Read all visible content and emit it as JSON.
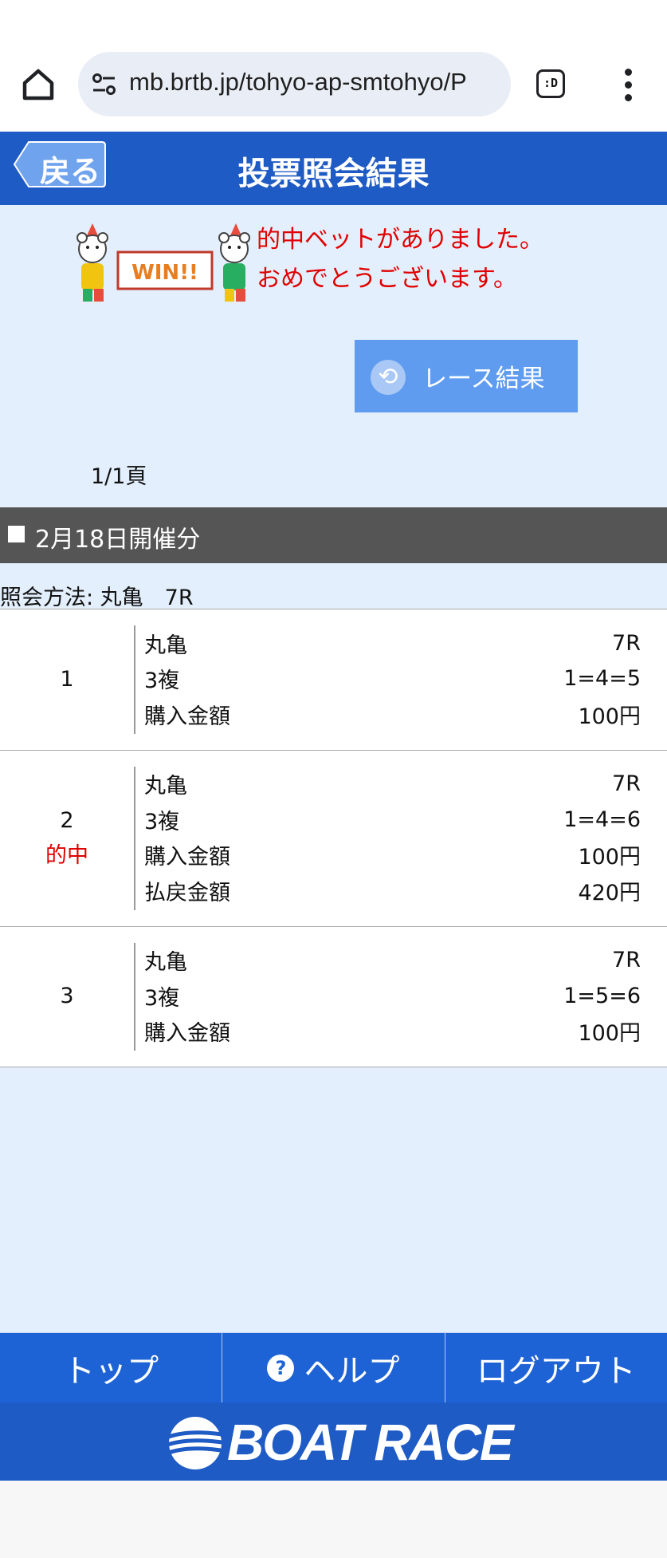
{
  "browser": {
    "url": "mb.brtb.jp/tohyo-ap-smtohyo/P",
    "tabs_label": ":D",
    "icons": [
      "home-icon",
      "site-settings-icon",
      "tab-switcher-icon",
      "more-vert-icon"
    ]
  },
  "header": {
    "back_label": "戻る",
    "title": "投票照会結果",
    "color": "#1f5bc5"
  },
  "win_banner": {
    "sign_text": "WIN!!",
    "line1": "的中ベットがありました。",
    "line2": "おめでとうございます。",
    "message_color": "#e00000"
  },
  "race_result_button": {
    "label": "レース結果",
    "icon": "undo-icon"
  },
  "pager": "1/1頁",
  "section": {
    "label": "2月18日開催分"
  },
  "query_method": "照会方法: 丸亀　7R",
  "bets": [
    {
      "no": "1",
      "hit": "",
      "lines": [
        {
          "label": "丸亀",
          "value": "7R"
        },
        {
          "label": "3複",
          "value": "1=4=5"
        },
        {
          "label": "購入金額",
          "value": "100円"
        }
      ]
    },
    {
      "no": "2",
      "hit": "的中",
      "lines": [
        {
          "label": "丸亀",
          "value": "7R"
        },
        {
          "label": "3複",
          "value": "1=4=6"
        },
        {
          "label": "購入金額",
          "value": "100円"
        },
        {
          "label": "払戻金額",
          "value": "420円"
        }
      ]
    },
    {
      "no": "3",
      "hit": "",
      "lines": [
        {
          "label": "丸亀",
          "value": "7R"
        },
        {
          "label": "3複",
          "value": "1=5=6"
        },
        {
          "label": "購入金額",
          "value": "100円"
        }
      ]
    }
  ],
  "bottom_nav": {
    "top": "トップ",
    "help": "ヘルプ",
    "logout": "ログアウト"
  },
  "brand": "BOAT RACE"
}
